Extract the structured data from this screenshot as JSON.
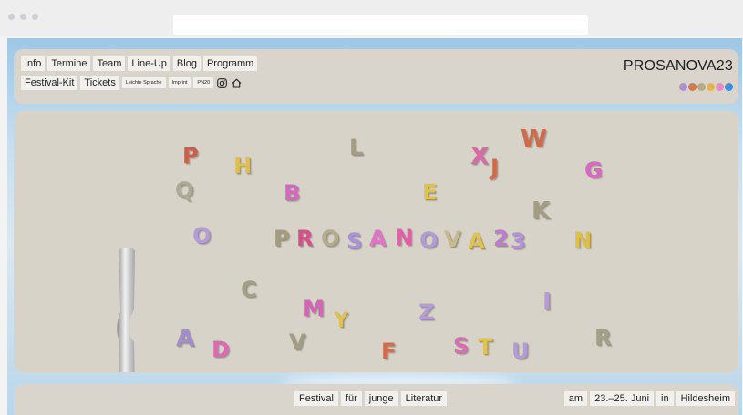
{
  "nav": {
    "row1": [
      "Info",
      "Termine",
      "Team",
      "Line-Up",
      "Blog",
      "Programm"
    ],
    "row2": [
      "Festival-Kit",
      "Tickets"
    ],
    "row2_small": [
      "Leichte Sprache",
      "Imprint",
      "PN20"
    ]
  },
  "icons": {
    "instagram": "instagram-icon",
    "home": "home-icon"
  },
  "brand": {
    "title": "PROSANOVA23",
    "dot_colors": [
      "#b08fcf",
      "#d07a52",
      "#b9a989",
      "#e0b84a",
      "#e38bc7",
      "#3c8fd6"
    ]
  },
  "hero": {
    "word": [
      "P",
      "R",
      "O",
      "S",
      "A",
      "N",
      "O",
      "V",
      "A",
      "2",
      "3"
    ],
    "word_colors": [
      "#a59c7f",
      "#d84f8b",
      "#b6ac8c",
      "#a992d6",
      "#e373c8",
      "#e05fa7",
      "#b19cd8",
      "#c7bb8c",
      "#e0c24e",
      "#c17ad4",
      "#b292d7"
    ],
    "scatter": [
      "P",
      "H",
      "L",
      "X",
      "J",
      "W",
      "G",
      "Q",
      "B",
      "E",
      "K",
      "O",
      "N",
      "C",
      "M",
      "Y",
      "Z",
      "I",
      "A",
      "D",
      "V",
      "F",
      "S",
      "T",
      "U",
      "R"
    ],
    "scatter_colors": [
      "#c9604c",
      "#e0bf4d",
      "#a49d7f",
      "#d86aa8",
      "#cf6a4a",
      "#cf6a4a",
      "#da68c2",
      "#aeaa95",
      "#d666c2",
      "#e0c24e",
      "#a39e82",
      "#b69bd9",
      "#dfbf45",
      "#a49f86",
      "#d564b8",
      "#e0c24e",
      "#b59dd8",
      "#b49ad9",
      "#a38ecd",
      "#dd6ab6",
      "#a59d82",
      "#d96a48",
      "#dd6ab6",
      "#e0c24e",
      "#b29bd8",
      "#a4a086"
    ]
  },
  "footer": {
    "left": [
      "Festival",
      "für",
      "junge",
      "Literatur"
    ],
    "right": [
      "am",
      "23.–25. Juni",
      "in",
      "Hildesheim"
    ]
  }
}
